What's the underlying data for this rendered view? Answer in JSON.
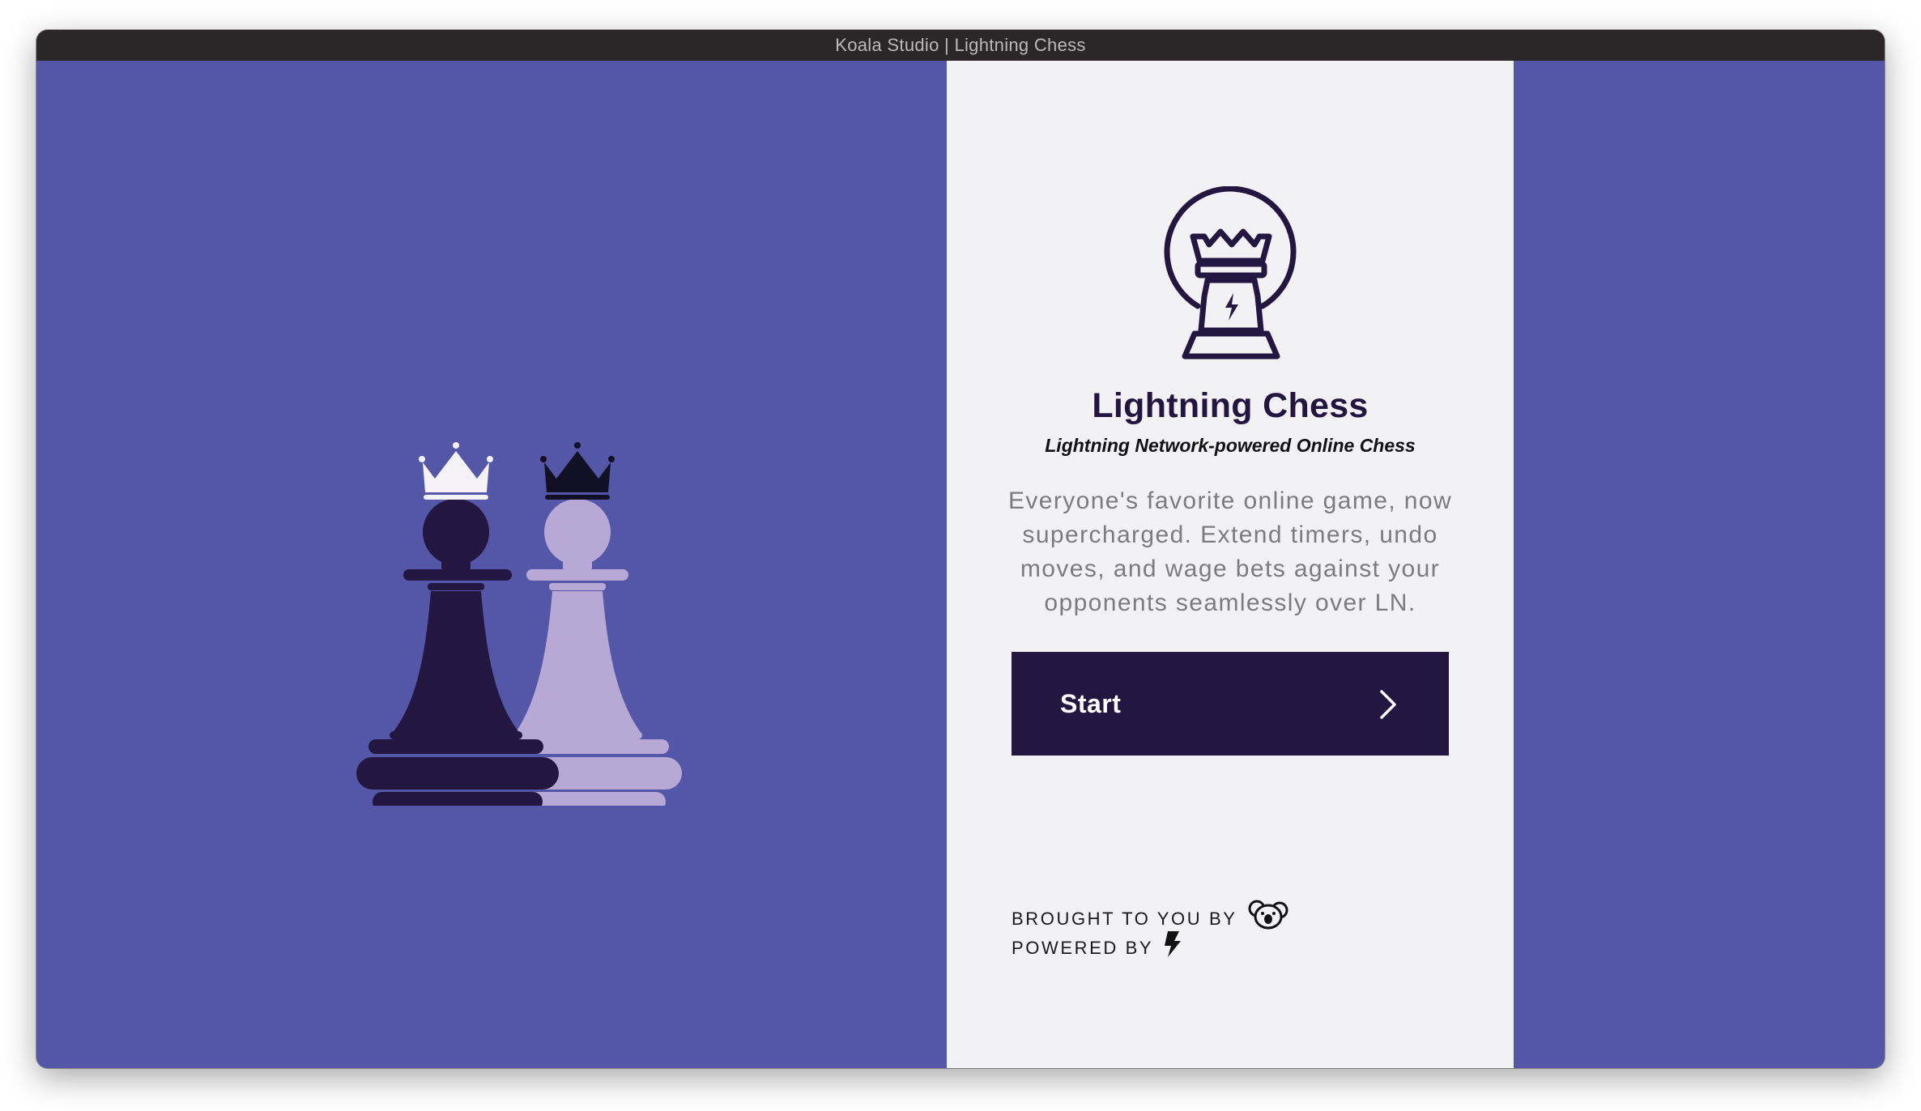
{
  "window": {
    "title": "Koala Studio | Lightning Chess"
  },
  "colors": {
    "background": "#5457a8",
    "panel": "#f2f1f4",
    "accent_dark": "#231641",
    "piece_light": "#b7a8d6",
    "text_muted": "#7c7b80"
  },
  "hero": {
    "icon_dark_pawn": "dark-pawn-with-white-crown",
    "icon_light_pawn": "light-pawn-with-black-crown"
  },
  "app": {
    "logo_icon": "lightning-rook-logo",
    "title": "Lightning Chess",
    "subtitle": "Lightning Network-powered Online Chess",
    "description": "Everyone's favorite online game, now supercharged. Extend timers, undo moves, and wage bets against your opponents seamlessly over LN."
  },
  "start_button": {
    "label": "Start",
    "icon": "chevron-right-icon"
  },
  "credits": {
    "brought_by_label": "BROUGHT TO YOU BY",
    "brought_by_icon": "koala-icon",
    "powered_by_label": "POWERED BY",
    "powered_by_icon": "lightning-bolt-icon"
  }
}
